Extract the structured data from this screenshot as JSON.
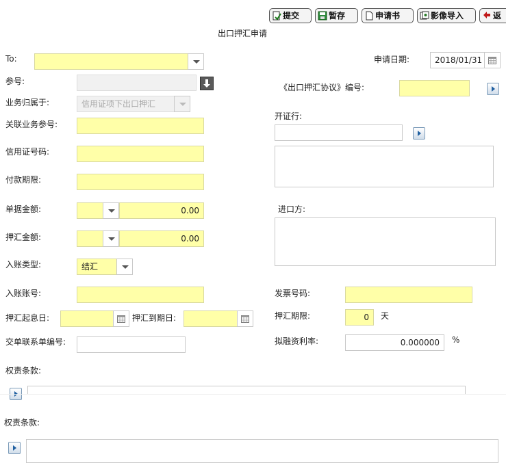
{
  "toolbar": {
    "submit": "提交",
    "save": "暂存",
    "application": "申请书",
    "image_import": "影像导入",
    "back": "返"
  },
  "page_title": "出口押汇申请",
  "form": {
    "to_label": "To:",
    "to_value": "",
    "apply_date_label": "申请日期:",
    "apply_date_value": "2018/01/31",
    "ref_label": "参号:",
    "ref_value": "",
    "agreement_label": "《出口押汇协议》编号:",
    "agreement_value": "",
    "business_label": "业务归属于:",
    "business_value": "信用证项下出口押汇",
    "related_ref_label": "关联业务参号:",
    "related_ref_value": "",
    "issuing_bank_label": "开证行:",
    "issuing_bank_value": "",
    "issuing_bank_detail": "",
    "lc_no_label": "信用证号码:",
    "lc_no_value": "",
    "payment_term_label": "付款期限:",
    "payment_term_value": "",
    "doc_amount_label": "单据金额:",
    "doc_currency": "",
    "doc_amount": "0.00",
    "importer_label": "进口方:",
    "importer_value": "",
    "nego_amount_label": "押汇金额:",
    "nego_currency": "",
    "nego_amount": "0.00",
    "entry_type_label": "入账类型:",
    "entry_type_value": "结汇",
    "entry_account_label": "入账账号:",
    "entry_account_value": "",
    "invoice_no_label": "发票号码:",
    "invoice_no_value": "",
    "start_date_label": "押汇起息日:",
    "start_date_value": "",
    "due_date_label": "押汇到期日:",
    "due_date_value": "",
    "nego_period_label": "押汇期限:",
    "nego_period_value": "0",
    "nego_period_unit": "天",
    "contact_no_label": "交单联系单编号:",
    "contact_no_value": "",
    "rate_label": "拟融资利率:",
    "rate_value": "0.000000",
    "rate_unit": "%",
    "terms_label_1": "权责条款:",
    "terms_label_2": "权责条款:"
  },
  "icons": {
    "submit": "submit-doc-icon",
    "save": "save-disk-icon",
    "application": "document-icon",
    "image_import": "image-import-icon",
    "back": "back-arrows-icon",
    "calendar": "calendar-icon",
    "dropdown": "chevron-down-icon",
    "expand": "chevron-right-icon",
    "download": "download-arrow-icon"
  },
  "colors": {
    "required_field_bg": "#ffffa8",
    "disabled_field_bg": "#f1f1f1",
    "accent_blue": "#1f5fa0"
  }
}
